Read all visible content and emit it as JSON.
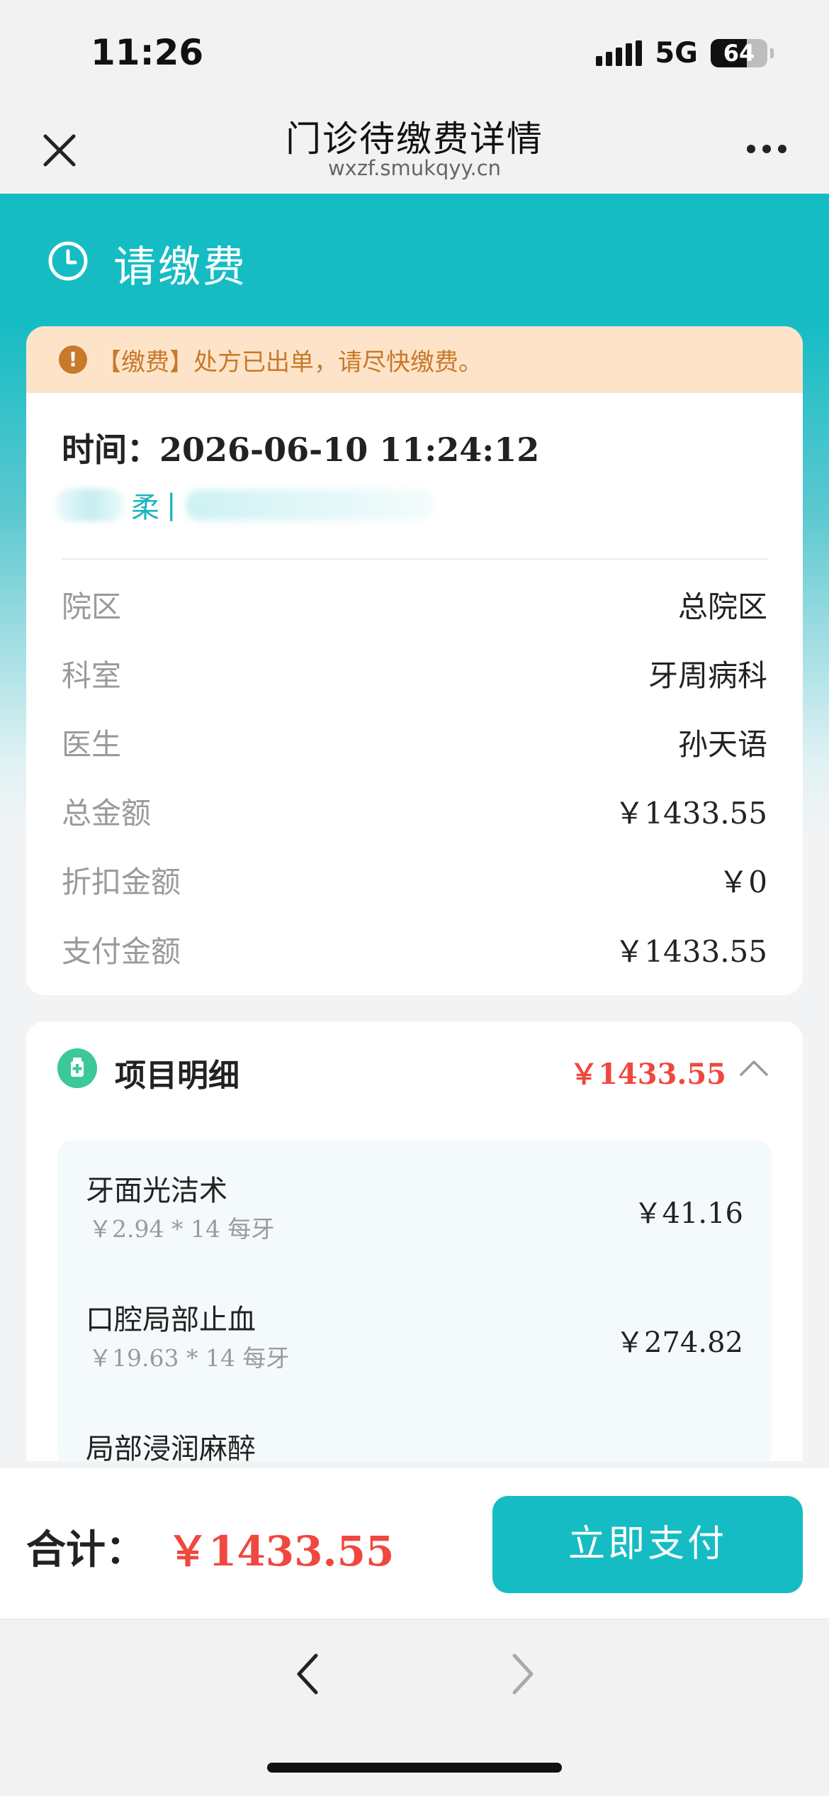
{
  "status": {
    "time": "11:26",
    "network": "5G",
    "battery": "64",
    "battery_level": 0.64
  },
  "nav": {
    "title": "门诊待缴费详情",
    "subtitle": "wxzf.smukqyy.cn"
  },
  "banner": {
    "title": "请缴费"
  },
  "notice": {
    "icon_text": "!",
    "text": "【缴费】处方已出单，请尽快缴费。"
  },
  "visit": {
    "time_label": "时间：",
    "time_value": "2026-06-10 11:24:12",
    "patient_name": "柔",
    "patient_sep": "|"
  },
  "info_rows": [
    {
      "label": "院区",
      "value": "总院区"
    },
    {
      "label": "科室",
      "value": "牙周病科"
    },
    {
      "label": "医生",
      "value": "孙天语"
    },
    {
      "label": "总金额",
      "value": "￥1433.55"
    },
    {
      "label": "折扣金额",
      "value": "￥0"
    },
    {
      "label": "支付金额",
      "value": "￥1433.55"
    }
  ],
  "detail": {
    "title": "项目明细",
    "total": "￥1433.55",
    "items": [
      {
        "name": "牙面光洁术",
        "sub": "￥2.94 * 14 每牙",
        "price": "￥41.16"
      },
      {
        "name": "口腔局部止血",
        "sub": "￥19.63 * 14 每牙",
        "price": "￥274.82"
      },
      {
        "name": "局部浸润麻醉",
        "sub": "",
        "price": ""
      }
    ]
  },
  "paybar": {
    "label": "合计：",
    "amount": "￥1433.55",
    "button": "立即支付"
  },
  "colors": {
    "accent": "#16bcc4",
    "price_red": "#f0473f",
    "notice_bg": "#fde4c9",
    "notice_text": "#c8792a"
  },
  "icons": {
    "close": "close-icon",
    "more": "more-icon",
    "clock": "clock-icon",
    "medicine": "medicine-box-icon",
    "chevron": "chevron-up-icon",
    "back": "back-arrow-icon",
    "forward": "forward-arrow-icon"
  }
}
